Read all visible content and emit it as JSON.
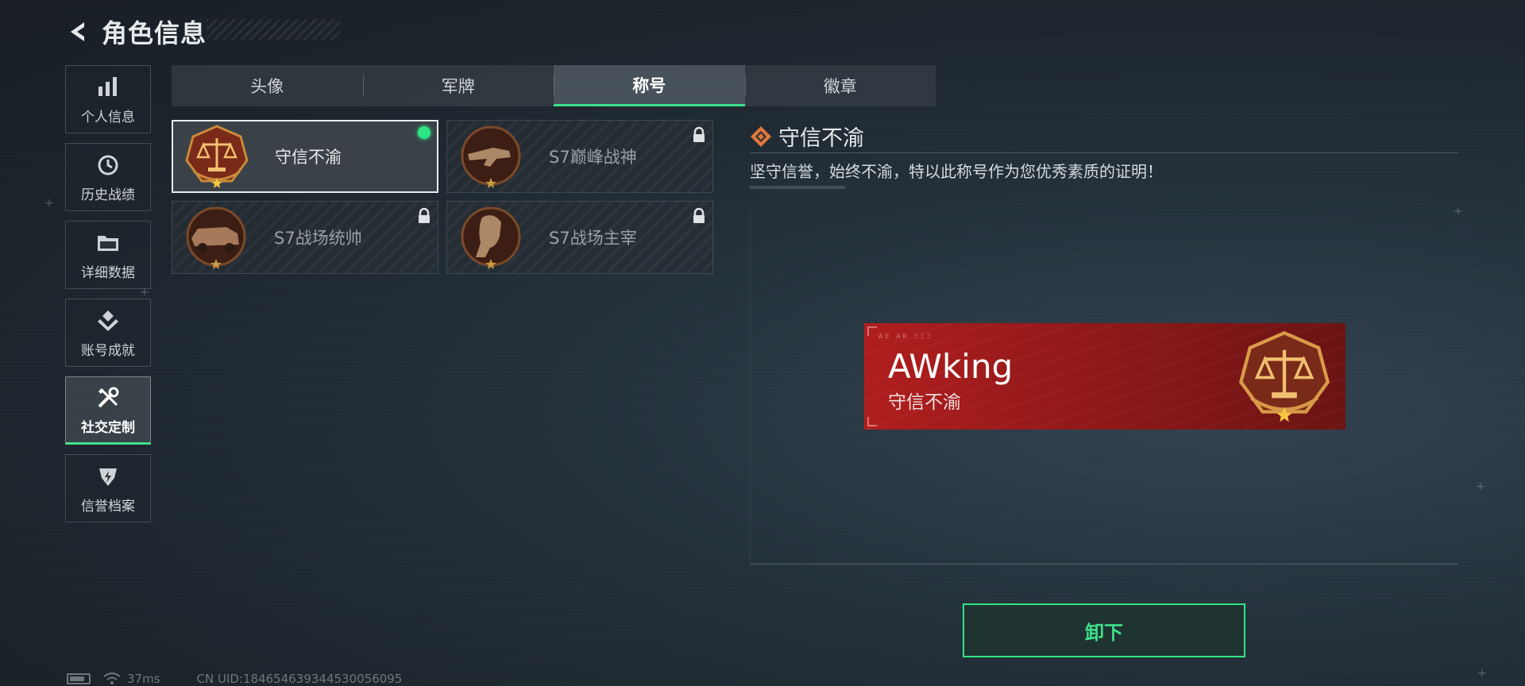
{
  "header": {
    "title": "角色信息"
  },
  "sidebar": {
    "items": [
      {
        "label": "个人信息",
        "icon": "bar-chart-icon",
        "active": false
      },
      {
        "label": "历史战绩",
        "icon": "history-clock-icon",
        "active": false
      },
      {
        "label": "详细数据",
        "icon": "folder-icon",
        "active": false
      },
      {
        "label": "账号成就",
        "icon": "achievement-icon",
        "active": false
      },
      {
        "label": "社交定制",
        "icon": "tools-icon",
        "active": true
      },
      {
        "label": "信誉档案",
        "icon": "credit-shield-icon",
        "active": false
      }
    ]
  },
  "tabs": [
    {
      "label": "头像",
      "active": false
    },
    {
      "label": "军牌",
      "active": false
    },
    {
      "label": "称号",
      "active": true
    },
    {
      "label": "徽章",
      "active": false
    }
  ],
  "titles": [
    {
      "name": "守信不渝",
      "selected": true,
      "equipped": true,
      "locked": false,
      "emblem": "scales-emblem-icon"
    },
    {
      "name": "S7巅峰战神",
      "selected": false,
      "equipped": false,
      "locked": true,
      "emblem": "rifle-emblem-icon"
    },
    {
      "name": "S7战场统帅",
      "selected": false,
      "equipped": false,
      "locked": true,
      "emblem": "vehicle-emblem-icon"
    },
    {
      "name": "S7战场主宰",
      "selected": false,
      "equipped": false,
      "locked": true,
      "emblem": "soldier-emblem-icon"
    }
  ],
  "detail": {
    "title": "守信不渝",
    "description": "坚守信誉，始终不渝，特以此称号作为您优秀素质的证明！",
    "banner": {
      "player_name": "AWking",
      "title": "守信不渝",
      "tag": "AE AR ΞΞΞ"
    }
  },
  "actions": {
    "unequip_label": "卸下"
  },
  "status": {
    "ping": "37ms",
    "uid": "CN UID:18465463934453005609​5"
  },
  "colors": {
    "accent_green": "#2fe586",
    "banner_red": "#b01e1e",
    "emblem_gold": "#e0a54a"
  }
}
